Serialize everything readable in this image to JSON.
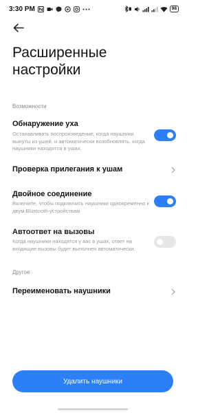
{
  "status_bar": {
    "time": "3:30 PM",
    "left_icons": [
      "notification-n-icon",
      "video-icon",
      "messenger-icon",
      "whatsapp-icon",
      "instagram-icon",
      "more-dots-icon"
    ],
    "right_icons": [
      "bluetooth-headset-icon",
      "sound-icon",
      "signal-icon",
      "signal-icon-2",
      "wifi-icon"
    ],
    "battery": "98"
  },
  "header": {
    "back_icon": "arrow-left-icon",
    "title": "Расширенные настройки"
  },
  "sections": [
    {
      "header": "Возможности",
      "items": [
        {
          "title": "Обнаружение уха",
          "description": "Останавливать воспроизведение, когда наушники вынуты из ушей, и автоматически возобновлять, когда наушники находятся в ушах.",
          "control": "toggle",
          "state": "on"
        },
        {
          "title": "Проверка прилегания к ушам",
          "control": "chevron",
          "icon": "chevron-right-icon"
        },
        {
          "title": "Двойное соединение",
          "description": "Включите, чтобы подключить наушники одновременно к двум Bluetooth-устройствам",
          "control": "toggle",
          "state": "on"
        },
        {
          "title": "Автоответ на вызовы",
          "description": "Когда наушники находятся у вас в ушах, ответ на входящие вызовы будет выполнен автоматически.",
          "control": "toggle",
          "state": "off-disabled"
        }
      ]
    },
    {
      "header": "Другое",
      "items": [
        {
          "title": "Переименовать наушники",
          "control": "chevron",
          "icon": "chevron-right-icon"
        }
      ]
    }
  ],
  "footer": {
    "delete_label": "Удалить наушники"
  },
  "colors": {
    "accent": "#2d7ff9",
    "toggle_off": "#e6e6e6",
    "secondary_text": "#9a9a9a",
    "section_header": "#8a8a8a"
  }
}
